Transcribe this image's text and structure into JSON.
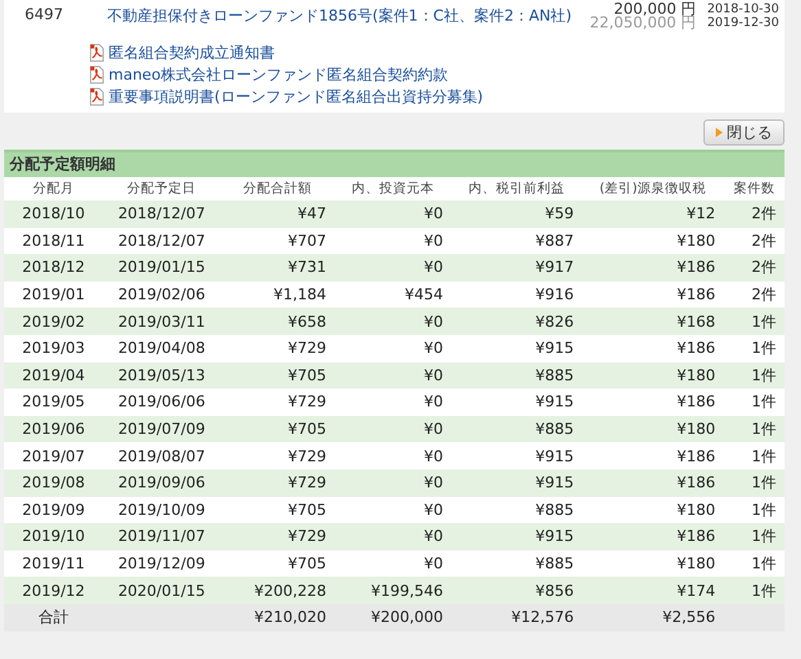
{
  "fund": {
    "id": "6497",
    "title": "不動産担保付きローンファンド1856号(案件1：C社、案件2：AN社)",
    "amounts": [
      "200,000 円",
      "22,050,000 円"
    ],
    "dates": [
      "2018-10-30",
      "2019-12-30"
    ]
  },
  "documents": [
    "匿名組合契約成立通知書",
    "maneo株式会社ローンファンド匿名組合契約約款",
    "重要事項説明書(ローンファンド匿名組合出資持分募集)"
  ],
  "close_button": "閉じる",
  "section_title": "分配予定額明細",
  "table": {
    "columns": [
      "分配月",
      "分配予定日",
      "分配合計額",
      "内、投資元本",
      "内、税引前利益",
      "(差引)源泉徴収税",
      "案件数"
    ],
    "rows": [
      [
        "2018/10",
        "2018/12/07",
        "¥47",
        "¥0",
        "¥59",
        "¥12",
        "2件"
      ],
      [
        "2018/11",
        "2018/12/07",
        "¥707",
        "¥0",
        "¥887",
        "¥180",
        "2件"
      ],
      [
        "2018/12",
        "2019/01/15",
        "¥731",
        "¥0",
        "¥917",
        "¥186",
        "2件"
      ],
      [
        "2019/01",
        "2019/02/06",
        "¥1,184",
        "¥454",
        "¥916",
        "¥186",
        "2件"
      ],
      [
        "2019/02",
        "2019/03/11",
        "¥658",
        "¥0",
        "¥826",
        "¥168",
        "1件"
      ],
      [
        "2019/03",
        "2019/04/08",
        "¥729",
        "¥0",
        "¥915",
        "¥186",
        "1件"
      ],
      [
        "2019/04",
        "2019/05/13",
        "¥705",
        "¥0",
        "¥885",
        "¥180",
        "1件"
      ],
      [
        "2019/05",
        "2019/06/06",
        "¥729",
        "¥0",
        "¥915",
        "¥186",
        "1件"
      ],
      [
        "2019/06",
        "2019/07/09",
        "¥705",
        "¥0",
        "¥885",
        "¥180",
        "1件"
      ],
      [
        "2019/07",
        "2019/08/07",
        "¥729",
        "¥0",
        "¥915",
        "¥186",
        "1件"
      ],
      [
        "2019/08",
        "2019/09/06",
        "¥729",
        "¥0",
        "¥915",
        "¥186",
        "1件"
      ],
      [
        "2019/09",
        "2019/10/09",
        "¥705",
        "¥0",
        "¥885",
        "¥180",
        "1件"
      ],
      [
        "2019/10",
        "2019/11/07",
        "¥729",
        "¥0",
        "¥915",
        "¥186",
        "1件"
      ],
      [
        "2019/11",
        "2019/12/09",
        "¥705",
        "¥0",
        "¥885",
        "¥180",
        "1件"
      ],
      [
        "2019/12",
        "2020/01/15",
        "¥200,228",
        "¥199,546",
        "¥856",
        "¥174",
        "1件"
      ]
    ],
    "total": {
      "label": "合計",
      "values": [
        "¥210,020",
        "¥200,000",
        "¥12,576",
        "¥2,556"
      ]
    }
  }
}
